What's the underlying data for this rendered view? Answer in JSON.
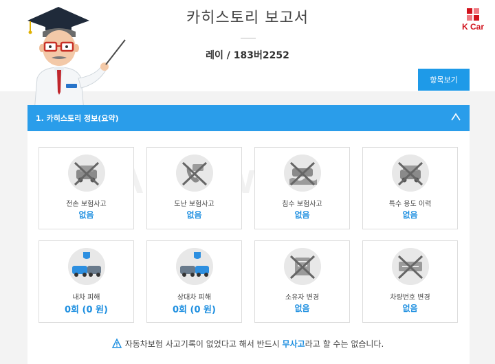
{
  "header": {
    "title": "카히스토리 보고서",
    "vehicle": "레이 / 183버2252",
    "view_items_button": "항목보기"
  },
  "brand": {
    "logo_text": "K Car",
    "accent": "#d1121c"
  },
  "watermark": "Autowini",
  "panel": {
    "title": "1. 카히스토리 정보(요약)",
    "accent": "#2a9dea",
    "value_color": "#1e8fe0",
    "cards": [
      {
        "label": "전손 보험사고",
        "value": "없음",
        "icon": "total-loss-car-icon"
      },
      {
        "label": "도난 보험사고",
        "value": "없음",
        "icon": "theft-phone-icon"
      },
      {
        "label": "침수 보험사고",
        "value": "없음",
        "icon": "flood-car-icon"
      },
      {
        "label": "특수 용도 이력",
        "value": "없음",
        "icon": "special-use-car-icon"
      },
      {
        "label": "내차 피해",
        "value": "0회 (0 원)",
        "icon": "own-car-damage-icon"
      },
      {
        "label": "상대차 피해",
        "value": "0회 (0 원)",
        "icon": "other-car-damage-icon"
      },
      {
        "label": "소유자 변경",
        "value": "없음",
        "icon": "owner-change-icon"
      },
      {
        "label": "차량번호 변경",
        "value": "없음",
        "icon": "plate-change-icon"
      }
    ]
  },
  "notice": {
    "before": "자동차보험 사고기록이 없었다고 해서 반드시 ",
    "highlight": "무사고",
    "after": "라고 할 수는 없습니다."
  }
}
